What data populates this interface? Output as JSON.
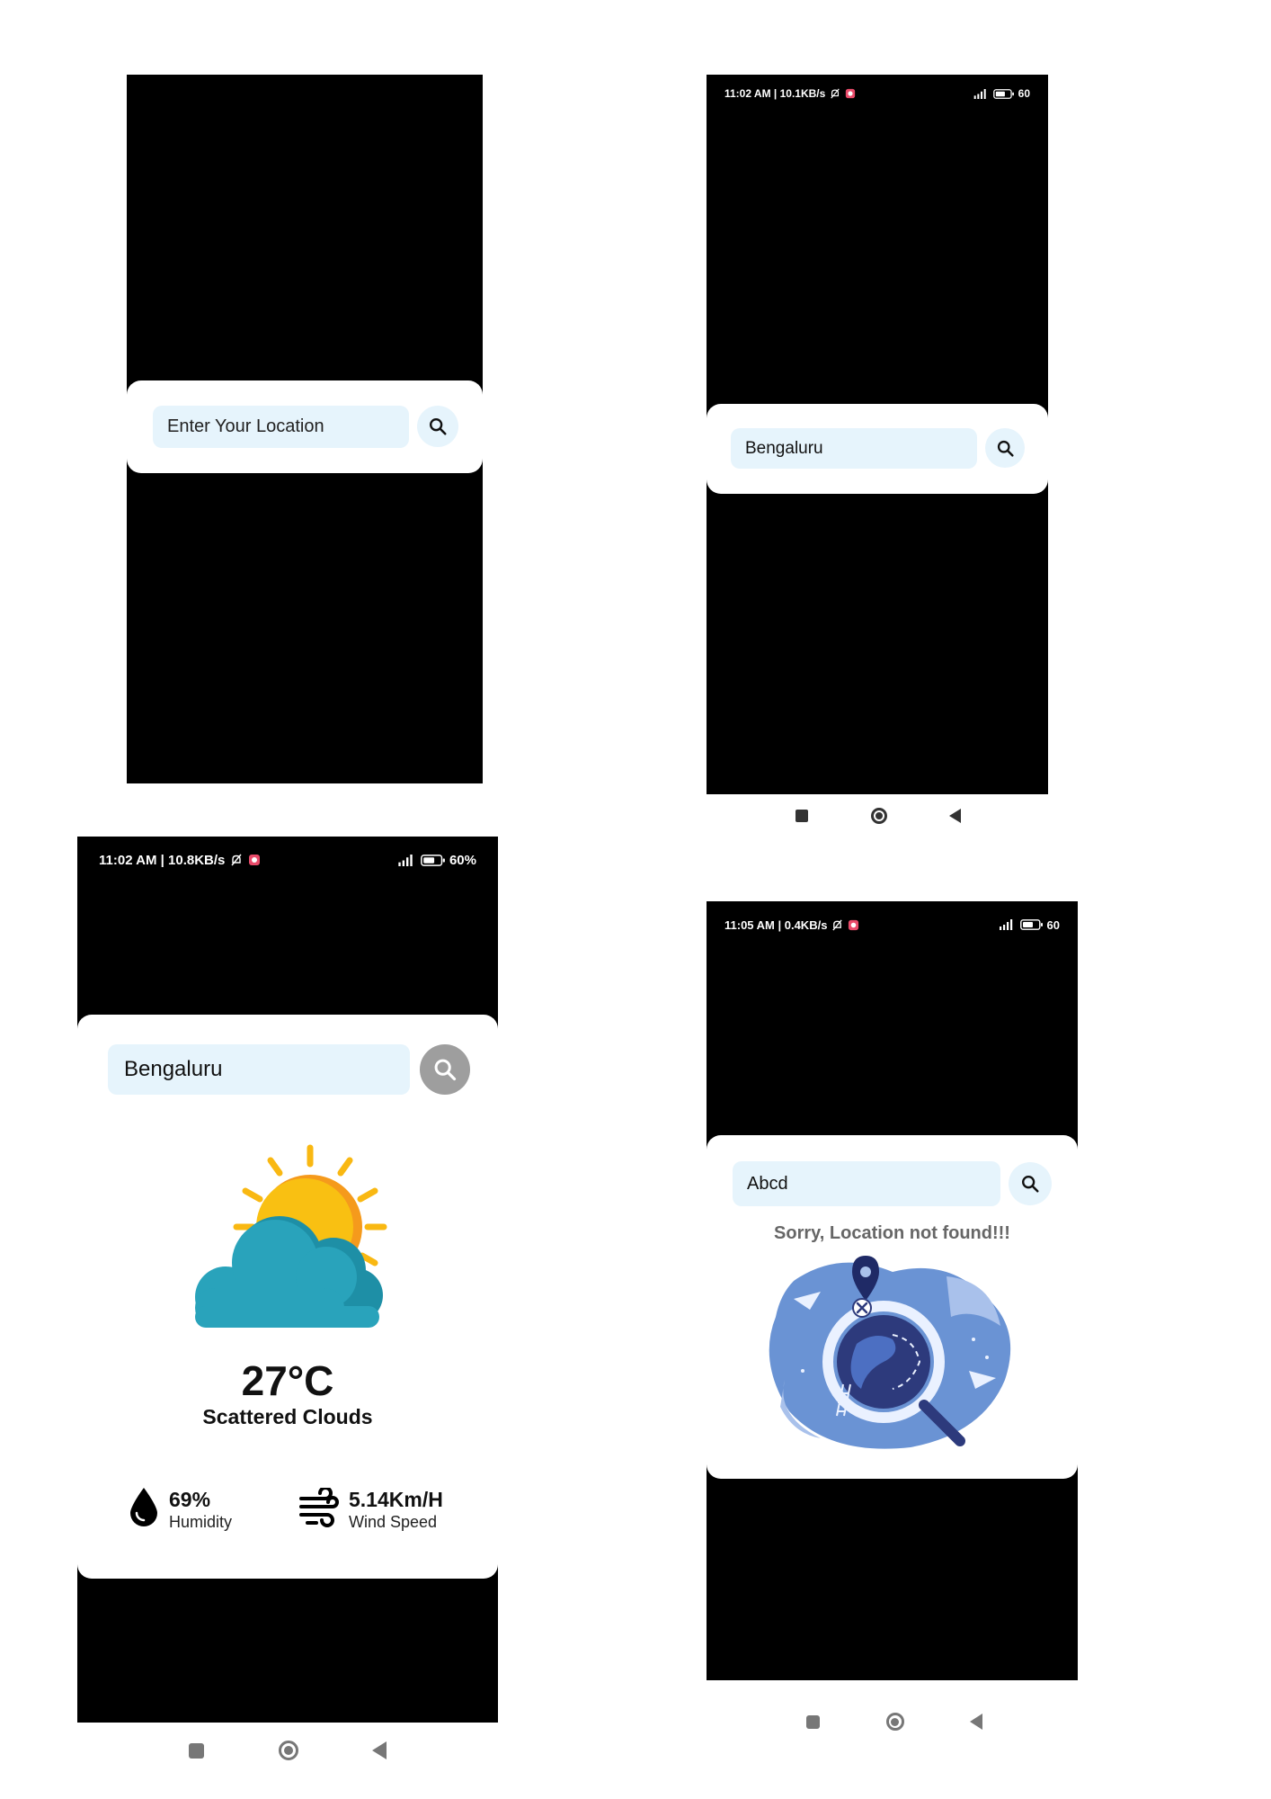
{
  "screen1": {
    "search": {
      "placeholder": "Enter Your Location",
      "value": ""
    }
  },
  "screen2": {
    "status": {
      "left": "11:02 AM | 10.1KB/s",
      "battery": "60"
    },
    "search": {
      "value": "Bengaluru"
    }
  },
  "screen3": {
    "status": {
      "left": "11:02 AM | 10.8KB/s",
      "battery": "60%"
    },
    "search": {
      "value": "Bengaluru"
    },
    "weather": {
      "temperature": "27°C",
      "description": "Scattered Clouds",
      "humidity_value": "69%",
      "humidity_label": "Humidity",
      "wind_value": "5.14Km/H",
      "wind_label": "Wind Speed"
    }
  },
  "screen4": {
    "status": {
      "left": "11:05 AM | 0.4KB/s",
      "battery": "60"
    },
    "search": {
      "value": "Abcd"
    },
    "error_message": "Sorry, Location not found!!!"
  },
  "colors": {
    "input_bg": "#e6f4fc",
    "sun": "#f9b812",
    "cloud": "#29a3bb",
    "illustration": "#6a93d4"
  },
  "icons": [
    "search-icon",
    "droplet-icon",
    "wind-icon",
    "stop-nav-icon",
    "home-nav-icon",
    "back-nav-icon",
    "mute-icon",
    "signal-icon",
    "battery-icon"
  ]
}
